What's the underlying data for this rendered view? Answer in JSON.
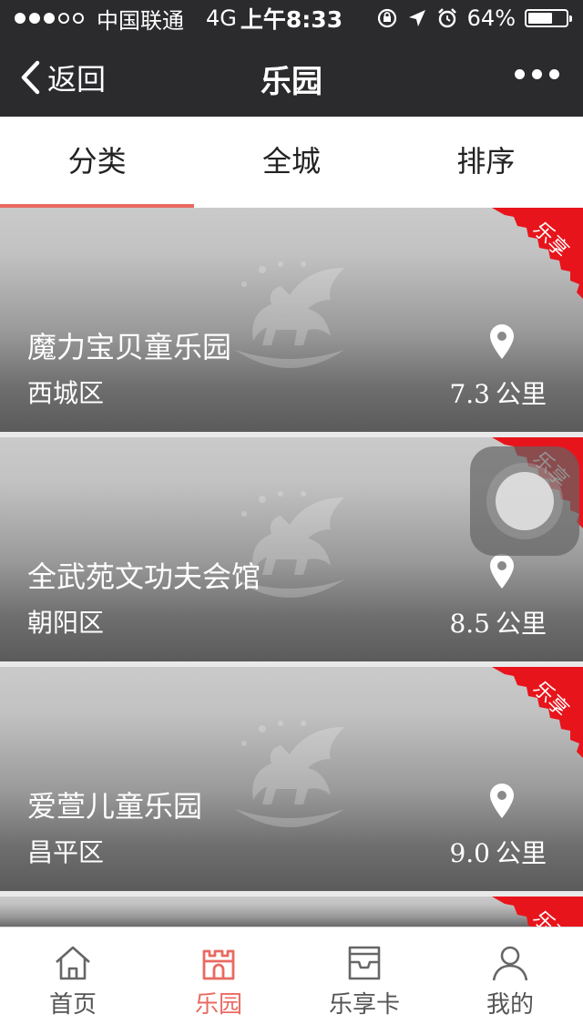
{
  "status": {
    "carrier": "中国联通",
    "network": "4G",
    "time": "上午8:33",
    "battery": "64%",
    "battery_level": 0.64
  },
  "nav": {
    "back_label": "返回",
    "title": "乐园"
  },
  "tabs": [
    {
      "label": "分类"
    },
    {
      "label": "全城"
    },
    {
      "label": "排序"
    }
  ],
  "badge": "乐享",
  "cards": [
    {
      "name": "魔力宝贝童乐园",
      "district": "西城区",
      "distance": "7.3",
      "unit": "公里"
    },
    {
      "name": "全武苑文功夫会馆",
      "district": "朝阳区",
      "distance": "8.5",
      "unit": "公里"
    },
    {
      "name": "爱萱儿童乐园",
      "district": "昌平区",
      "distance": "9.0",
      "unit": "公里"
    }
  ],
  "tabbar": [
    {
      "label": "首页",
      "icon": "home-icon"
    },
    {
      "label": "乐园",
      "icon": "castle-icon"
    },
    {
      "label": "乐享卡",
      "icon": "card-box-icon"
    },
    {
      "label": "我的",
      "icon": "person-icon"
    }
  ],
  "colors": {
    "accent": "#e96a62",
    "ribbon": "#e8141b",
    "topbar": "#2b2b2d"
  }
}
